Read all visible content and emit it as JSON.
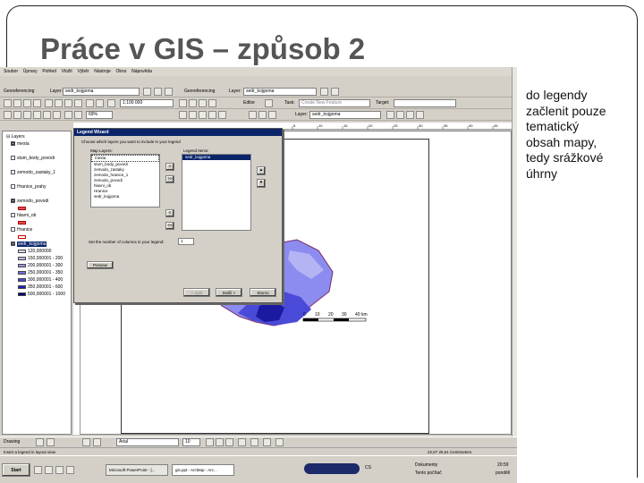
{
  "slide": {
    "title": "Práce v GIS – způsob 2",
    "side_lines": [
      "do legendy",
      "začlenit pouze",
      "tematický",
      "obsah mapy,",
      "tedy srážkové",
      "úhrny"
    ]
  },
  "app": {
    "menu": [
      "Soubor",
      "Úpravy",
      "Pohled",
      "Vložit",
      "Výběr",
      "Nástroje",
      "Okno",
      "Nápověda"
    ],
    "toolbar1": {
      "layer_label": "Layer:",
      "layer_value": "sedr_kojgoma",
      "georef_label": "Georeferencing",
      "layer2_label": "Layer:",
      "layer2_value": "sedr_kojgoma"
    },
    "toolbar2": {
      "scale_value": "1:100 000",
      "zoom_value": "69%",
      "editor_label": "Editor",
      "task_label": "Task:",
      "task_value": "Create New Feature",
      "target_label": "Target:"
    },
    "toolbar3": {
      "layer_label": "Layer:",
      "layer_value": "sedr_kojgoma"
    },
    "ruler_ticks": [
      "5",
      "10",
      "15",
      "20",
      "25",
      "30",
      "35",
      "40",
      "45",
      "50"
    ]
  },
  "toc": {
    "header": "Layers",
    "layers": [
      "mesta",
      "stum_body_povodi",
      "zemodo_zastaky_1",
      "Hranice_prahy",
      "zemodo_povodi",
      "hlavni_ob",
      "Hranice",
      "sedr_kojgoma"
    ],
    "legend_items": [
      "120,000000",
      "150,000001 - 200",
      "200,000001 - 300",
      "250,000001 - 350",
      "300,000001 - 400",
      "350,000001 - 600",
      "500,000001 - 1000"
    ],
    "legend_colors": [
      "#d8d8f8",
      "#b8b8f0",
      "#9898e8",
      "#7070e0",
      "#4848d0",
      "#2020b8",
      "#000080"
    ]
  },
  "dialog": {
    "title": "Legend Wizard",
    "prompt": "Choose which layers you want to include in your legend",
    "map_layers_label": "Map Layers:",
    "legend_items_label": "Legend Items:",
    "map_layers": [
      "mesta",
      "stum_body_povodi",
      "zemodo_zastaky",
      "zemodo_hranice_1",
      "zemodo_povodi",
      "hlavni_ob",
      "Hranice",
      "sedr_kojgoma"
    ],
    "legend_items": [
      "sedr_kojgoma"
    ],
    "columns_label": "Set the number of columns in your legend:",
    "columns_value": "1",
    "preview_label": "Preview",
    "back_label": "< Zpět",
    "next_label": "Další >",
    "cancel_label": "Storno"
  },
  "scalebar": {
    "labels": [
      "0",
      "10",
      "20",
      "30",
      "40 km"
    ]
  },
  "drawbar": {
    "drawing_label": "Drawing",
    "font_value": "Arial",
    "size_value": "10"
  },
  "status": {
    "text": "Insert a legend in layout view",
    "coords": "22,67  25,61 Centimeters"
  },
  "taskbar": {
    "start_label": "Start",
    "tasks": [
      "Microsoft PowerPoint - [...",
      "gis.ppt - ArcMap - Arc..."
    ],
    "tray": [
      "Dokumenty",
      "Tento počítač"
    ],
    "lang": "CS",
    "clock": "20:59",
    "day": "pondělí"
  }
}
